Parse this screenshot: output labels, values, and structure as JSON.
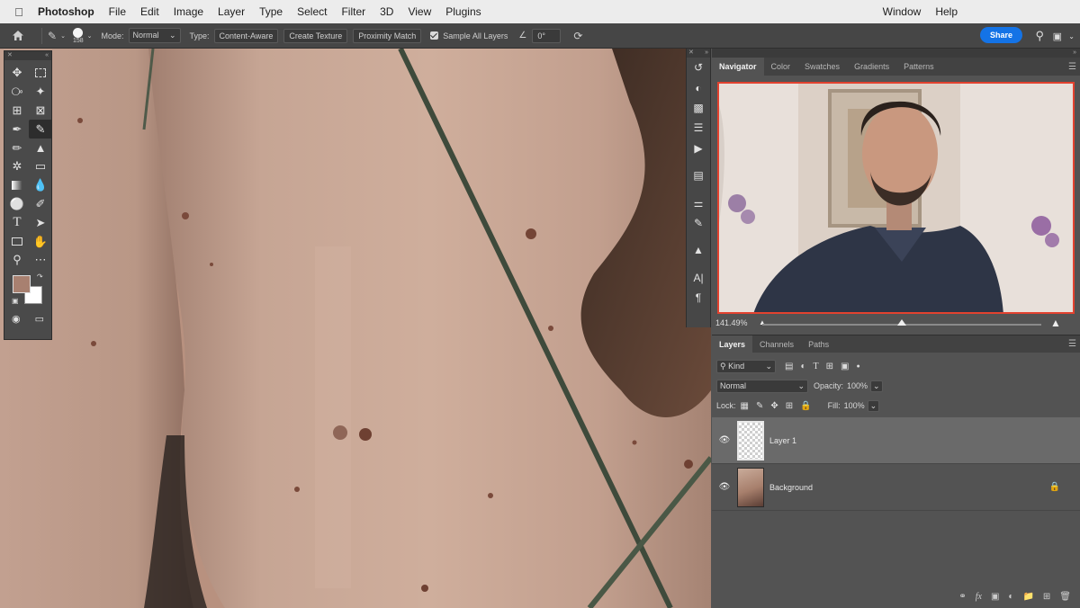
{
  "menubar": {
    "app": "Photoshop",
    "items": [
      "File",
      "Edit",
      "Image",
      "Layer",
      "Type",
      "Select",
      "Filter",
      "3D",
      "View",
      "Plugins"
    ],
    "right_items": [
      "Window",
      "Help"
    ]
  },
  "options": {
    "brush_size": "158",
    "mode_label": "Mode:",
    "mode_value": "Normal",
    "type_label": "Type:",
    "type_options": [
      "Content-Aware",
      "Create Texture",
      "Proximity Match"
    ],
    "sample_all": "Sample All Layers",
    "angle": "0°",
    "share": "Share"
  },
  "tools": {
    "swatch_fg": "#a88070",
    "swatch_bg": "#ffffff"
  },
  "navigator": {
    "tabs": [
      "Navigator",
      "Color",
      "Swatches",
      "Gradients",
      "Patterns"
    ],
    "zoom": "141.49%",
    "zoom_fraction": 0.5
  },
  "layers": {
    "tabs": [
      "Layers",
      "Channels",
      "Paths"
    ],
    "filter_kind": "Kind",
    "blend_mode": "Normal",
    "opacity_label": "Opacity:",
    "opacity": "100%",
    "lock_label": "Lock:",
    "fill_label": "Fill:",
    "fill": "100%",
    "items": [
      {
        "name": "Layer 1",
        "selected": true
      },
      {
        "name": "Background",
        "selected": false
      }
    ]
  }
}
